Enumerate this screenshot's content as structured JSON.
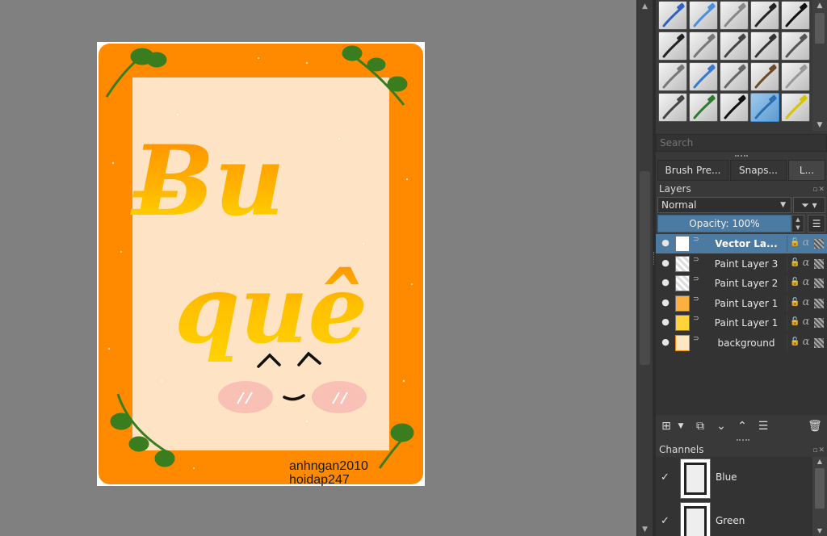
{
  "canvas": {
    "lettering_line1": "Ƀu",
    "lettering_line2": "quê",
    "face": "^ ^",
    "watermark_line1": "anhngan2010",
    "watermark_line2": "hoidap247",
    "colors": {
      "frame": "#ff8a00",
      "inner": "#fee3c4",
      "leaf": "#3a7d1f",
      "blush": "#f9c0b6"
    }
  },
  "brushes": {
    "search_placeholder": "Search",
    "presets": [
      "pen-blue",
      "marker-blue",
      "eraser",
      "ink-pen",
      "pen-black",
      "brush-dark",
      "pencil-grey",
      "charcoal",
      "fineliner",
      "brush-stroke",
      "pencil",
      "marker-blue-2",
      "pencil-soft",
      "brush-brown",
      "airbrush",
      "smudge",
      "fill-green",
      "ink",
      "watercolor-blue",
      "pencil-yellow"
    ],
    "selected_index": 18
  },
  "tabs": [
    {
      "label": "Brush Pre..."
    },
    {
      "label": "Snaps..."
    },
    {
      "label": "L..."
    }
  ],
  "layers_panel": {
    "title": "Layers",
    "blend_mode": "Normal",
    "opacity_label": "Opacity:  100%",
    "items": [
      {
        "name": "Vector La...",
        "selected": true,
        "thumb": "vector"
      },
      {
        "name": "Paint Layer 3",
        "selected": false,
        "thumb": "checker"
      },
      {
        "name": "Paint Layer 2",
        "selected": false,
        "thumb": "checker"
      },
      {
        "name": "Paint Layer 1",
        "selected": false,
        "thumb": "orange"
      },
      {
        "name": "Paint Layer 1",
        "selected": false,
        "thumb": "yellow"
      },
      {
        "name": "background",
        "selected": false,
        "thumb": "bg"
      }
    ]
  },
  "channels_panel": {
    "title": "Channels",
    "items": [
      {
        "name": "Blue",
        "checked": "✓"
      },
      {
        "name": "Green",
        "checked": "✓"
      }
    ]
  },
  "icons": {
    "eye": "visible-eye-icon",
    "lock": "lock-icon",
    "alpha": "alpha-lock-icon",
    "filter": "filter-icon"
  }
}
